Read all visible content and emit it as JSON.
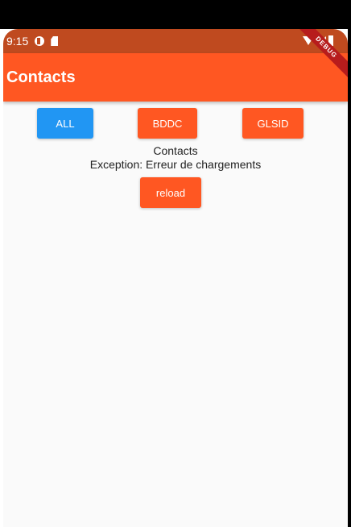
{
  "status_bar": {
    "time": "9:15",
    "icons": [
      "data-saver-icon",
      "sd-card-icon",
      "wifi-icon",
      "signal-icon",
      "battery-icon"
    ],
    "background_color": "#bf4a1f"
  },
  "app_bar": {
    "title": "Contacts",
    "background_color": "#ff5722",
    "debug_banner": "DEBUG"
  },
  "filter_buttons": [
    {
      "label": "ALL",
      "color": "#2196f3",
      "selected": true
    },
    {
      "label": "BDDC",
      "color": "#ff5722",
      "selected": false
    },
    {
      "label": "GLSID",
      "color": "#ff5722",
      "selected": false
    }
  ],
  "content": {
    "heading": "Contacts",
    "error_message": "Exception: Erreur de chargements",
    "reload_label": "reload"
  }
}
